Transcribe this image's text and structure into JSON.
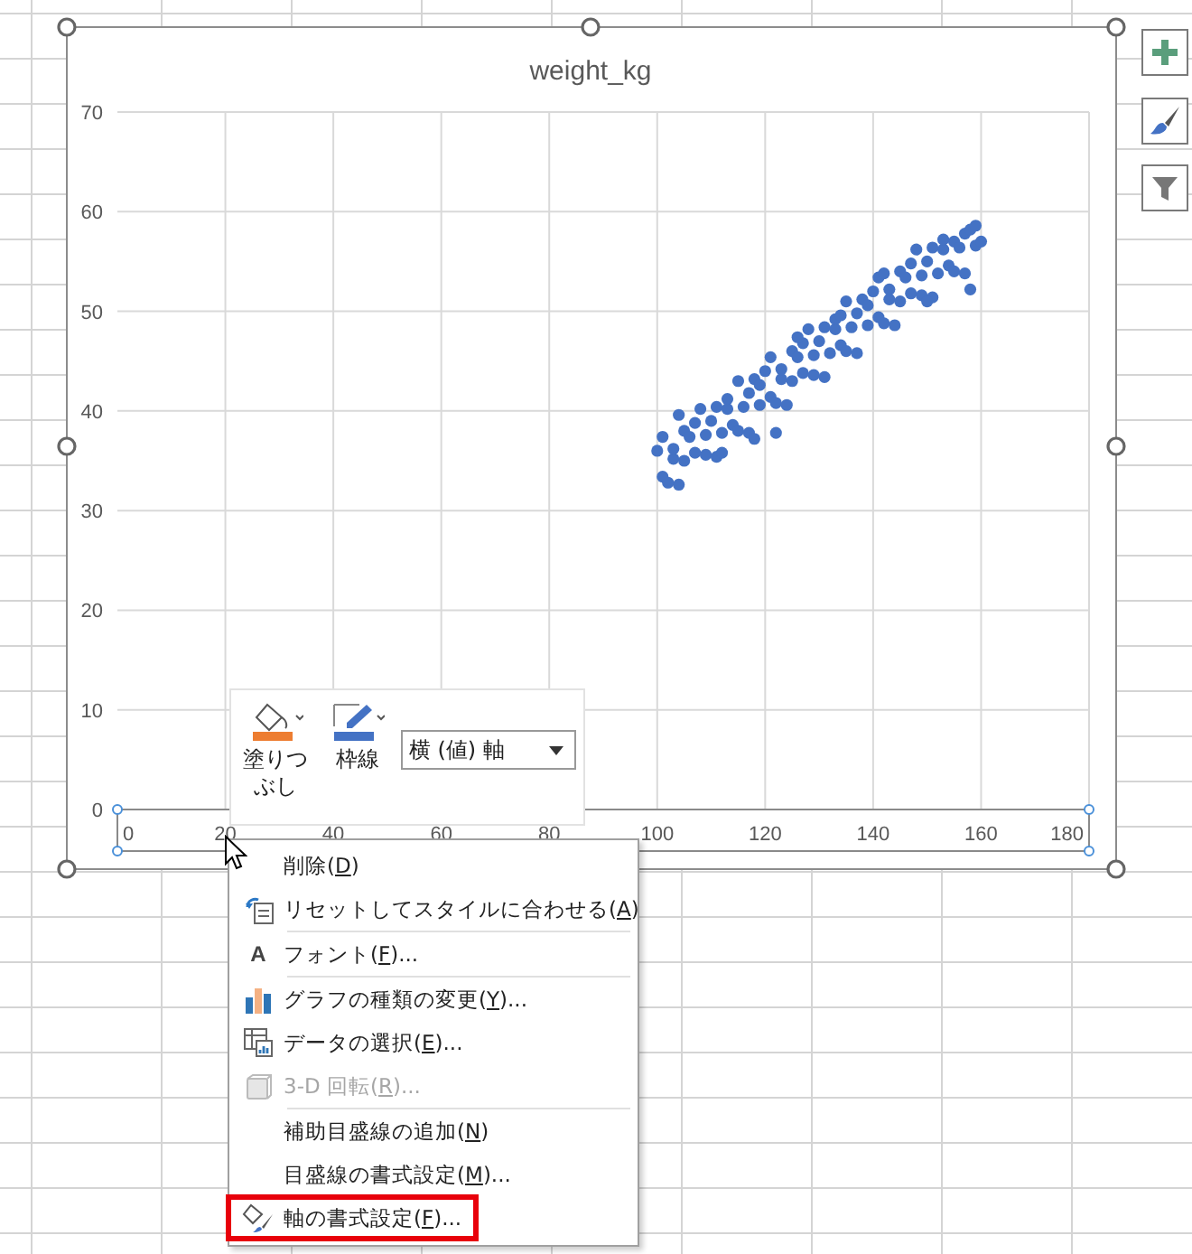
{
  "chart": {
    "chart_data": {
      "type": "scatter",
      "title": "weight_kg",
      "grid": true,
      "xlim": [
        0,
        180
      ],
      "ylim": [
        0,
        70
      ],
      "xticks": [
        0,
        20,
        40,
        60,
        80,
        100,
        120,
        140,
        160,
        180
      ],
      "yticks": [
        0,
        10,
        20,
        30,
        40,
        50,
        60,
        70
      ],
      "x": [
        100,
        101,
        101,
        102,
        103,
        103,
        104,
        105,
        105,
        106,
        107,
        107,
        108,
        109,
        109,
        110,
        111,
        111,
        112,
        113,
        113,
        114,
        115,
        115,
        116,
        117,
        117,
        118,
        119,
        119,
        120,
        121,
        121,
        122,
        123,
        123,
        124,
        125,
        125,
        126,
        127,
        127,
        128,
        129,
        129,
        130,
        131,
        131,
        132,
        133,
        133,
        134,
        135,
        135,
        136,
        137,
        137,
        138,
        139,
        139,
        140,
        141,
        141,
        142,
        143,
        143,
        144,
        145,
        145,
        146,
        147,
        147,
        148,
        149,
        149,
        150,
        151,
        151,
        152,
        153,
        153,
        154,
        155,
        155,
        156,
        157,
        157,
        158,
        159,
        159,
        160,
        104,
        112,
        118,
        126,
        134,
        142,
        150,
        158,
        122
      ],
      "series": [
        {
          "color": "#4472c4",
          "values": [
            36,
            33.4,
            37.4,
            32.8,
            35.2,
            36.2,
            32.6,
            38,
            35,
            37.4,
            38.8,
            35.8,
            40.2,
            35.6,
            37.6,
            39,
            35.4,
            40.4,
            37.8,
            40.2,
            41.2,
            38.6,
            43,
            38,
            40.4,
            41.8,
            37.8,
            43.2,
            40.6,
            42.6,
            44,
            41.4,
            45.4,
            40.8,
            43.2,
            44.2,
            40.6,
            46,
            43,
            45.4,
            46.8,
            43.8,
            48.2,
            43.6,
            45.6,
            47,
            43.4,
            48.4,
            45.8,
            48.2,
            49.2,
            46.6,
            51,
            46,
            48.4,
            49.8,
            45.8,
            51.2,
            48.6,
            50.6,
            52,
            49.4,
            53.4,
            48.8,
            51.2,
            52.2,
            48.6,
            54,
            51,
            53.4,
            54.8,
            51.8,
            56.2,
            51.6,
            53.6,
            55,
            51.4,
            56.4,
            53.8,
            56.2,
            57.2,
            54.6,
            57,
            54,
            56.4,
            57.8,
            53.8,
            58.2,
            56.6,
            58.6,
            57,
            39.6,
            35.8,
            37.2,
            47.4,
            49.6,
            53.8,
            51,
            52.2,
            37.8
          ]
        }
      ]
    }
  },
  "mini_toolbar": {
    "fill_label": "塗りつぶし",
    "outline_label": "枠線",
    "element_select": "横 (値) 軸"
  },
  "menu": {
    "groups": [
      {
        "items": [
          {
            "kind": "plain",
            "before": "削除(",
            "key": "D",
            "after": ")",
            "disabled": false,
            "highlighted": false
          },
          {
            "kind": "reset",
            "before": "リセットしてスタイルに合わせる(",
            "key": "A",
            "after": ")",
            "disabled": false,
            "highlighted": false
          }
        ]
      },
      {
        "items": [
          {
            "kind": "font",
            "glyph": "A",
            "before": "フォント(",
            "key": "F",
            "after": ")...",
            "disabled": false,
            "highlighted": false
          }
        ]
      },
      {
        "items": [
          {
            "kind": "bars",
            "before": "グラフの種類の変更(",
            "key": "Y",
            "after": ")...",
            "disabled": false,
            "highlighted": false
          },
          {
            "kind": "data",
            "before": "データの選択(",
            "key": "E",
            "after": ")...",
            "disabled": false,
            "highlighted": false
          },
          {
            "kind": "cube",
            "before": "3-D 回転(",
            "key": "R",
            "after": ")...",
            "disabled": true,
            "highlighted": false
          }
        ]
      },
      {
        "items": [
          {
            "kind": "plain",
            "before": "補助目盛線の追加(",
            "key": "N",
            "after": ")",
            "disabled": false,
            "highlighted": false
          },
          {
            "kind": "plain",
            "before": "目盛線の書式設定(",
            "key": "M",
            "after": ")...",
            "disabled": false,
            "highlighted": false
          },
          {
            "kind": "format",
            "before": "軸の書式設定(",
            "key": "F",
            "after": ")...",
            "disabled": false,
            "highlighted": true
          }
        ]
      }
    ]
  }
}
